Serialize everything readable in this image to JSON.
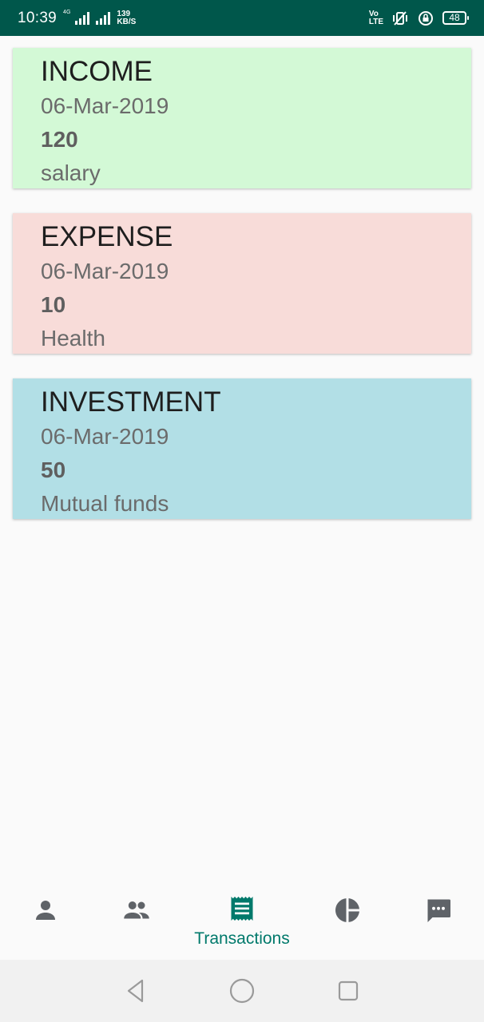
{
  "status_bar": {
    "time": "10:39",
    "network_tag": "4G",
    "data_speed_value": "139",
    "data_speed_unit": "KB/S",
    "volte_top": "Vo",
    "volte_bottom": "LTE",
    "battery": "48"
  },
  "transactions": [
    {
      "type": "INCOME",
      "date": "06-Mar-2019",
      "amount": "120",
      "category": "salary",
      "color": "#d3f9d6"
    },
    {
      "type": "EXPENSE",
      "date": "06-Mar-2019",
      "amount": "10",
      "category": "Health",
      "color": "#f8dcd9"
    },
    {
      "type": "INVESTMENT",
      "date": "06-Mar-2019",
      "amount": "50",
      "category": "Mutual funds",
      "color": "#b2dfe6"
    }
  ],
  "bottom_nav": {
    "items": [
      {
        "icon": "person-icon",
        "label": ""
      },
      {
        "icon": "group-icon",
        "label": ""
      },
      {
        "icon": "receipt-icon",
        "label": "Transactions",
        "active": true
      },
      {
        "icon": "pie-chart-icon",
        "label": ""
      },
      {
        "icon": "chat-icon",
        "label": ""
      }
    ],
    "active_color": "#00796b",
    "inactive_color": "#5f6368"
  },
  "system_nav": {
    "buttons": [
      "back-icon",
      "home-icon",
      "recents-icon"
    ]
  }
}
